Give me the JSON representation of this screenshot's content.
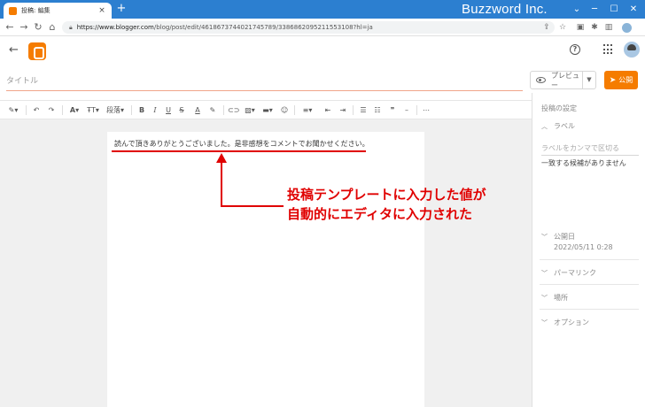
{
  "browser": {
    "tab_title": "投稿: 編集",
    "tab_close": "×",
    "new_tab": "+",
    "url_host": "https://www.blogger.com",
    "url_path": "/blog/post/edit/4618673744021745789/3386862095211553108?hl=ja",
    "brand": "Buzzword Inc.",
    "icons": [
      "back-arrow",
      "forward-arrow",
      "reload",
      "home",
      "lock",
      "share",
      "star",
      "extension",
      "puzzle",
      "sidebar",
      "profile"
    ]
  },
  "header": {
    "back": "←",
    "help": "?"
  },
  "editor": {
    "title_placeholder": "タイトル",
    "preview_label": "プレビュー",
    "publish_label": "公開",
    "toolbar": {
      "heading_label": "段落"
    },
    "content_text": "読んで頂きありがとうございました。是非感想をコメントでお聞かせください。"
  },
  "annotation": {
    "line1": "投稿テンプレートに入力した値が",
    "line2": "自動的にエディタに入力された",
    "color": "#e00000"
  },
  "sidebar": {
    "heading": "投稿の設定",
    "labels_section": "ラベル",
    "labels_placeholder": "ラベルをカンマで区切る",
    "labels_no_match": "一致する候補がありません",
    "published_section": "公開日",
    "published_value": "2022/05/11 0:28",
    "permalink_section": "パーマリンク",
    "location_section": "場所",
    "options_section": "オプション"
  },
  "colors": {
    "chrome_tabstrip": "#2c7fd0",
    "accent": "#f57c00"
  }
}
